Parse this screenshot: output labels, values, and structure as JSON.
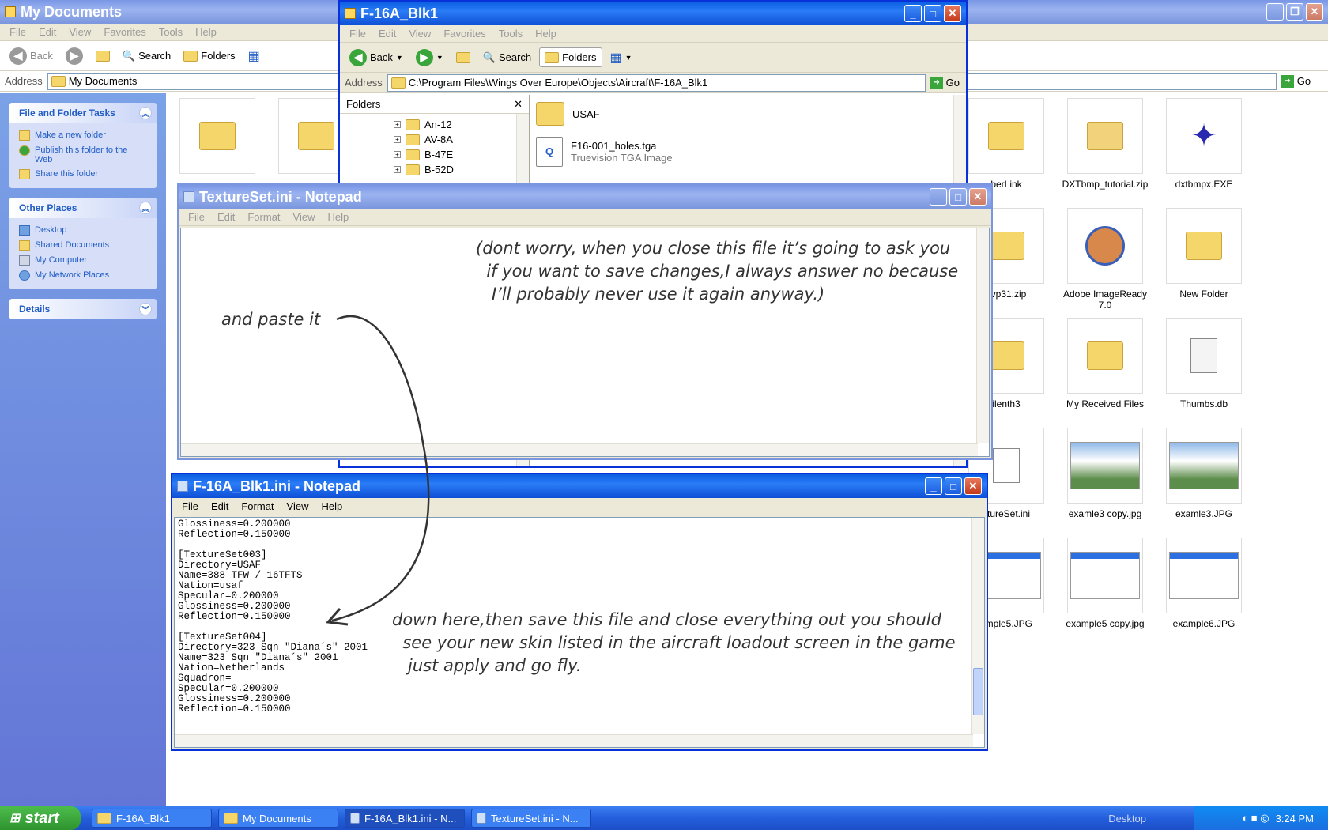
{
  "mydocs": {
    "title": "My Documents",
    "menu": [
      "File",
      "Edit",
      "View",
      "Favorites",
      "Tools",
      "Help"
    ],
    "back": "Back",
    "search": "Search",
    "folders": "Folders",
    "address_label": "Address",
    "address": "My Documents",
    "go": "Go",
    "tasks": {
      "title": "File and Folder Tasks",
      "items": [
        "Make a new folder",
        "Publish this folder to the Web",
        "Share this folder"
      ]
    },
    "other": {
      "title": "Other Places",
      "items": [
        "Desktop",
        "Shared Documents",
        "My Computer",
        "My Network Places"
      ]
    },
    "details": "Details",
    "files": [
      "berLink",
      "DXTbmp_tutorial.zip",
      "dxtbmpx.EXE",
      "cvp31.zip",
      "Adobe ImageReady 7.0",
      "New Folder",
      "ilenth3",
      "My Received Files",
      "Thumbs.db",
      "xtureSet.ini",
      "examle3 copy.jpg",
      "examle3.JPG",
      "ample5.JPG",
      "example5 copy.jpg",
      "example6.JPG"
    ]
  },
  "explorer": {
    "title": "F-16A_Blk1",
    "menu": [
      "File",
      "Edit",
      "View",
      "Favorites",
      "Tools",
      "Help"
    ],
    "back": "Back",
    "search": "Search",
    "folders": "Folders",
    "address_label": "Address",
    "address": "C:\\Program Files\\Wings Over Europe\\Objects\\Aircraft\\F-16A_Blk1",
    "go": "Go",
    "tree_title": "Folders",
    "tree": [
      "An-12",
      "AV-8A",
      "B-47E",
      "B-52D"
    ],
    "file1": "USAF",
    "file2_name": "F16-001_holes.tga",
    "file2_type": "Truevision TGA Image"
  },
  "notepad1": {
    "title": "TextureSet.ini - Notepad",
    "menu": [
      "File",
      "Edit",
      "Format",
      "View",
      "Help"
    ]
  },
  "notepad2": {
    "title": "F-16A_Blk1.ini - Notepad",
    "menu": [
      "File",
      "Edit",
      "Format",
      "View",
      "Help"
    ],
    "content": "Glossiness=0.200000\nReflection=0.150000\n\n[TextureSet003]\nDirectory=USAF\nName=388 TFW / 16TFTS\nNation=usaf\nSpecular=0.200000\nGlossiness=0.200000\nReflection=0.150000\n\n[TextureSet004]\nDirectory=323 Sqn \"Diana´s\" 2001\nName=323 Sqn \"Diana´s\" 2001\nNation=Netherlands\nSquadron=\nSpecular=0.200000\nGlossiness=0.200000\nReflection=0.150000"
  },
  "annotations": {
    "note1": "(dont worry, when you close this file it’s going to ask you\n  if you want to save changes,I always answer no because\n   I’ll probably never use it again anyway.)",
    "note2": "and paste it",
    "note3": "down here,then save this file and close everything out you should\n  see your new skin listed in the aircraft loadout screen in the game\n   just apply and go fly."
  },
  "taskbar": {
    "start": "start",
    "items": [
      "F-16A_Blk1",
      "My Documents",
      "F-16A_Blk1.ini - N...",
      "TextureSet.ini - N..."
    ],
    "desktop": "Desktop",
    "clock": "3:24 PM"
  }
}
